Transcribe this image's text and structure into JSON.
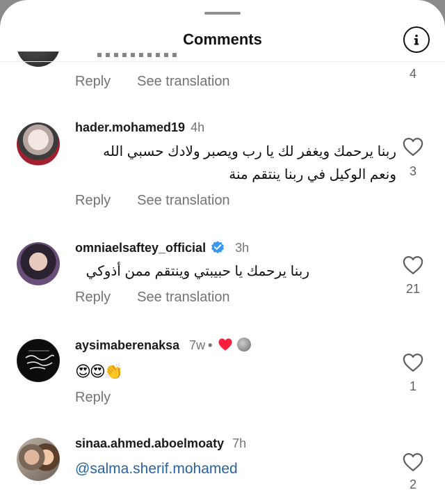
{
  "header": {
    "title": "Comments"
  },
  "reply_label": "Reply",
  "see_translation_label": "See translation",
  "partial_top": {
    "likes": "4"
  },
  "comments": [
    {
      "username": "hader.mohamed19",
      "time": "4h",
      "text_line1": "ربنا يرحمك ويغفر لك يا رب ويصبر ولادك حسبي الله",
      "text_line2": "ونعم الوكيل في ربنا ينتقم منة",
      "likes": "3"
    },
    {
      "username": "omniaelsaftey_official",
      "time": "3h",
      "text_line1": "ربنا يرحمك يا حبيبتي وينتقم ممن أذوكي",
      "likes": "21"
    },
    {
      "username": "aysimaberenaksa",
      "time": "7w",
      "separator": "•",
      "emojis": "😍😍👏",
      "likes": "1"
    },
    {
      "username": "sinaa.ahmed.aboelmoaty",
      "time": "7h",
      "mention": "@salma.sherif.mohamed",
      "likes": "2"
    }
  ],
  "colors": {
    "heart_red": "#ff1f3d",
    "verified_blue": "#3897f0",
    "mention_blue": "#2563a8"
  }
}
